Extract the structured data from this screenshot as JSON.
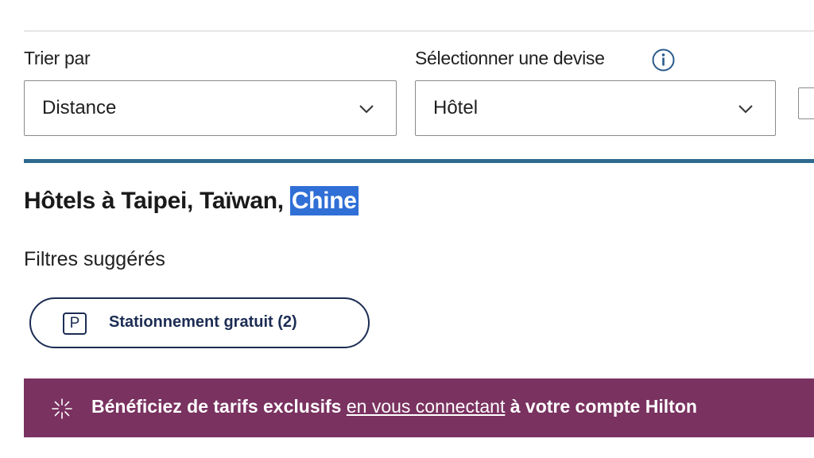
{
  "sort": {
    "label": "Trier par",
    "value": "Distance"
  },
  "currency": {
    "label": "Sélectionner une devise",
    "value": "Hôtel"
  },
  "heading": {
    "main": "Hôtels à Taipei, Taïwan, ",
    "highlighted": "Chine"
  },
  "filters": {
    "title": "Filtres suggérés",
    "chips": [
      {
        "icon": "parking-icon",
        "icon_glyph": "P",
        "label": "Stationnement gratuit (2)"
      }
    ]
  },
  "banner": {
    "prefix": "Bénéficiez de tarifs exclusifs ",
    "link": "en vous connectant",
    "suffix": " à votre compte Hilton",
    "icon": "sparkle-icon"
  },
  "colors": {
    "divider": "#2e6a8e",
    "banner_bg": "#7a3260",
    "chip_border": "#1c2d54",
    "highlight": "#2f6fd6"
  }
}
